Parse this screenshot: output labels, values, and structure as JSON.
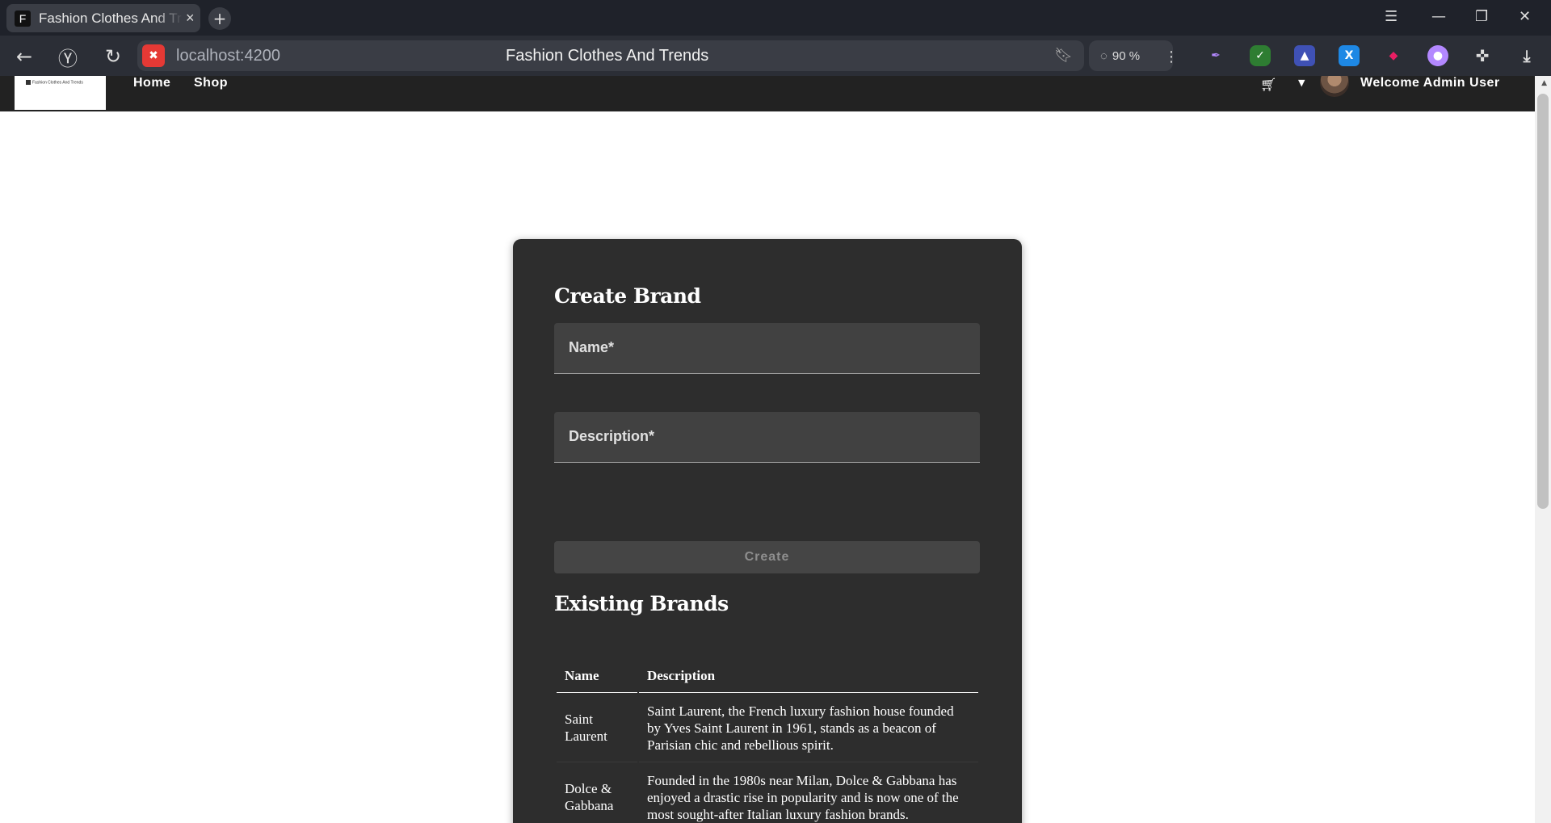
{
  "browser": {
    "tab_favicon": "F",
    "tab_title": "Fashion Clothes And Trends",
    "url": "localhost:4200",
    "page_title": "Fashion Clothes And Trends",
    "zoom": "90 %"
  },
  "app": {
    "logo_text": "Fashion Clothes And Trends",
    "nav": {
      "home": "Home",
      "shop": "Shop"
    },
    "welcome": "Welcome Admin User"
  },
  "create_form": {
    "title": "Create Brand",
    "name_label": "Name*",
    "description_label": "Description*",
    "create_label": "Create"
  },
  "existing": {
    "title": "Existing Brands",
    "columns": [
      "Name",
      "Description"
    ],
    "rows": [
      {
        "name": "Saint Laurent",
        "description": "Saint Laurent, the French luxury fashion house founded by Yves Saint Laurent in 1961, stands as a beacon of Parisian chic and rebellious spirit."
      },
      {
        "name": "Dolce & Gabbana",
        "description": "Founded in the 1980s near Milan, Dolce & Gabbana has enjoyed a drastic rise in popularity and is now one of the most sought-after Italian luxury fashion brands."
      }
    ]
  },
  "colors": {
    "card_bg": "#2d2d2d",
    "nav_bg": "#222222",
    "field_bg": "#414141",
    "button_bg": "#454545"
  }
}
